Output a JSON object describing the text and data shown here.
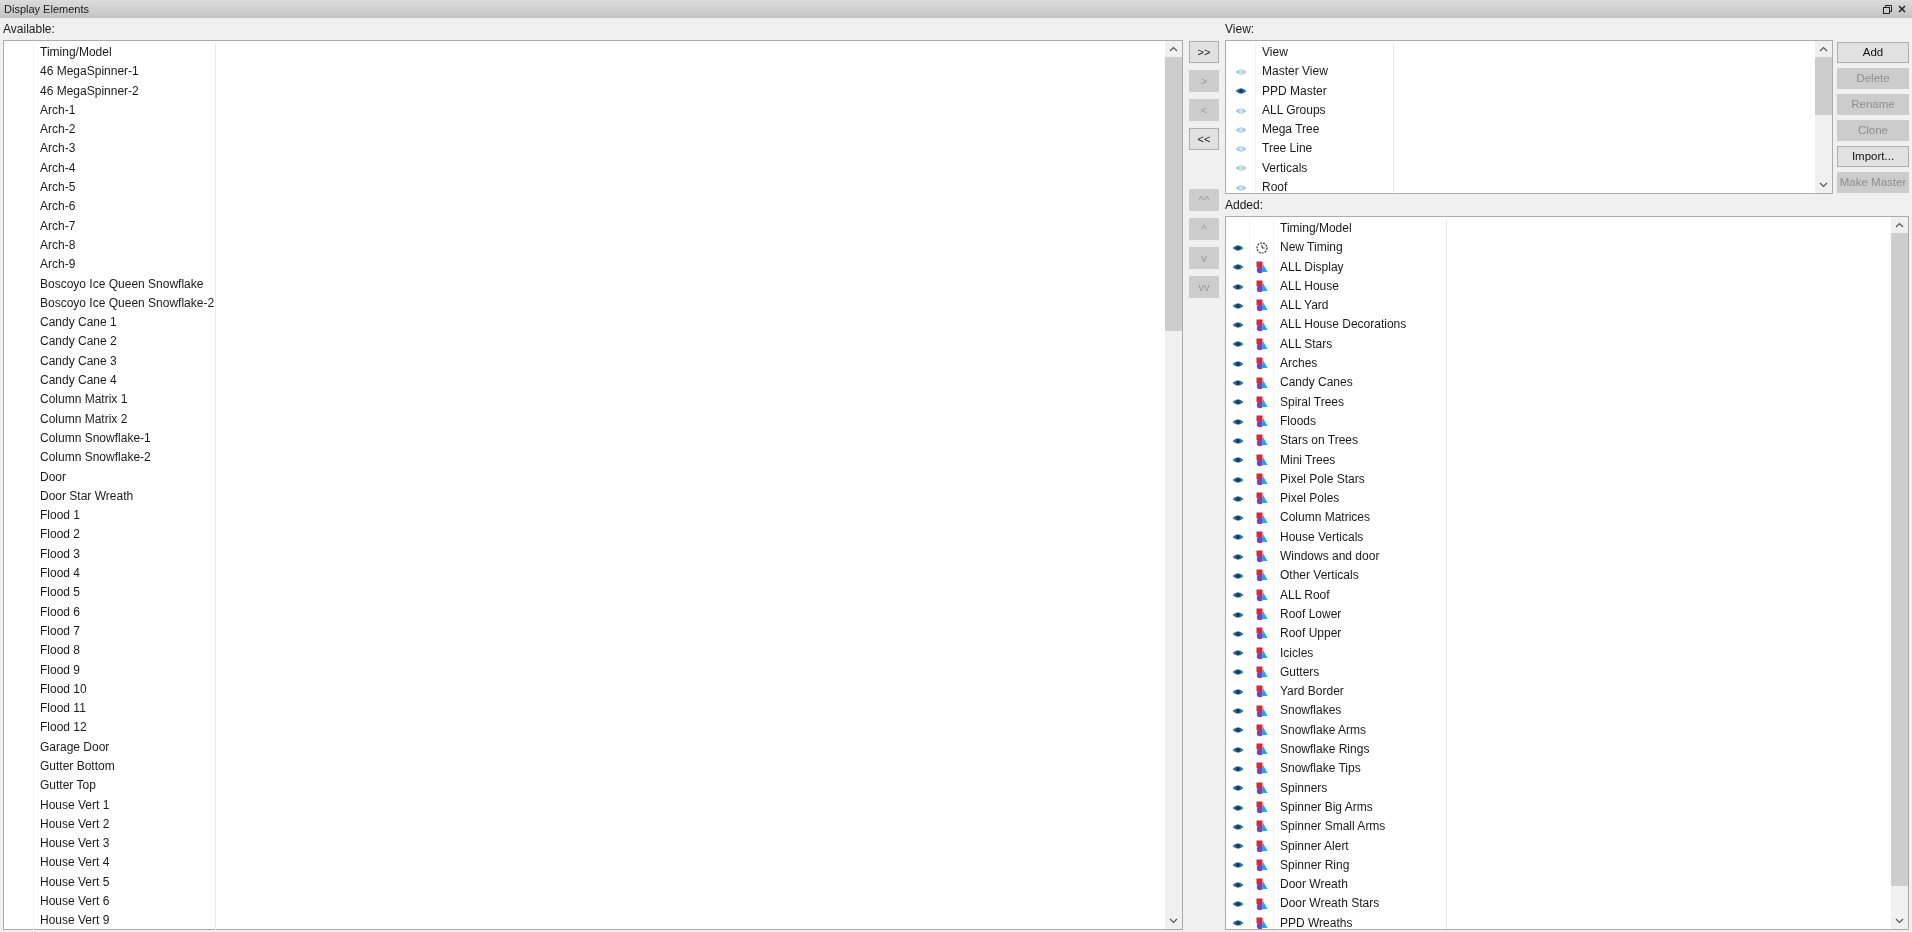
{
  "window": {
    "title": "Display Elements"
  },
  "available": {
    "label": "Available:",
    "header": "Timing/Model",
    "items": [
      "46 MegaSpinner-1",
      "46 MegaSpinner-2",
      "Arch-1",
      "Arch-2",
      "Arch-3",
      "Arch-4",
      "Arch-5",
      "Arch-6",
      "Arch-7",
      "Arch-8",
      "Arch-9",
      "Boscoyo Ice Queen Snowflake",
      "Boscoyo Ice Queen Snowflake-2",
      "Candy Cane 1",
      "Candy Cane 2",
      "Candy Cane 3",
      "Candy Cane 4",
      "Column Matrix 1",
      "Column Matrix 2",
      "Column Snowflake-1",
      "Column Snowflake-2",
      "Door",
      "Door Star Wreath",
      "Flood 1",
      "Flood 2",
      "Flood 3",
      "Flood 4",
      "Flood 5",
      "Flood 6",
      "Flood 7",
      "Flood 8",
      "Flood 9",
      "Flood 10",
      "Flood 11",
      "Flood 12",
      "Garage Door",
      "Gutter Bottom",
      "Gutter Top",
      "House Vert 1",
      "House Vert 2",
      "House Vert 3",
      "House Vert 4",
      "House Vert 5",
      "House Vert 6",
      "House Vert 9"
    ]
  },
  "transfer_buttons": [
    {
      "label": ">>",
      "disabled": false
    },
    {
      "label": ">",
      "disabled": true
    },
    {
      "label": "<",
      "disabled": true
    },
    {
      "label": "<<",
      "disabled": false
    }
  ],
  "order_buttons": [
    {
      "label": "^^",
      "disabled": true
    },
    {
      "label": "^",
      "disabled": true
    },
    {
      "label": "v",
      "disabled": true
    },
    {
      "label": "vv",
      "disabled": true
    }
  ],
  "view": {
    "label": "View:",
    "header": "View",
    "items": [
      {
        "name": "Master View",
        "selected": false
      },
      {
        "name": "PPD Master",
        "selected": true
      },
      {
        "name": "ALL Groups",
        "selected": false
      },
      {
        "name": "Mega Tree",
        "selected": false
      },
      {
        "name": "Tree Line",
        "selected": false
      },
      {
        "name": "Verticals",
        "selected": false
      },
      {
        "name": "Roof",
        "selected": false
      }
    ]
  },
  "view_buttons": [
    {
      "label": "Add",
      "disabled": false
    },
    {
      "label": "Delete",
      "disabled": true
    },
    {
      "label": "Rename",
      "disabled": true
    },
    {
      "label": "Clone",
      "disabled": true
    },
    {
      "label": "Import...",
      "disabled": false
    },
    {
      "label": "Make Master",
      "disabled": true
    }
  ],
  "added": {
    "label": "Added:",
    "header": "Timing/Model",
    "items": [
      {
        "name": "New Timing",
        "kind": "timing"
      },
      {
        "name": "ALL Display",
        "kind": "model"
      },
      {
        "name": "ALL House",
        "kind": "model"
      },
      {
        "name": "ALL Yard",
        "kind": "model"
      },
      {
        "name": "ALL House Decorations",
        "kind": "model"
      },
      {
        "name": "ALL Stars",
        "kind": "model"
      },
      {
        "name": "Arches",
        "kind": "model"
      },
      {
        "name": "Candy Canes",
        "kind": "model"
      },
      {
        "name": "Spiral Trees",
        "kind": "model"
      },
      {
        "name": "Floods",
        "kind": "model"
      },
      {
        "name": "Stars on Trees",
        "kind": "model"
      },
      {
        "name": "Mini Trees",
        "kind": "model"
      },
      {
        "name": "Pixel Pole Stars",
        "kind": "model"
      },
      {
        "name": "Pixel Poles",
        "kind": "model"
      },
      {
        "name": "Column Matrices",
        "kind": "model"
      },
      {
        "name": "House Verticals",
        "kind": "model"
      },
      {
        "name": "Windows and door",
        "kind": "model"
      },
      {
        "name": "Other Verticals",
        "kind": "model"
      },
      {
        "name": "ALL Roof",
        "kind": "model"
      },
      {
        "name": "Roof Lower",
        "kind": "model"
      },
      {
        "name": "Roof Upper",
        "kind": "model"
      },
      {
        "name": "Icicles",
        "kind": "model"
      },
      {
        "name": "Gutters",
        "kind": "model"
      },
      {
        "name": "Yard Border",
        "kind": "model"
      },
      {
        "name": "Snowflakes",
        "kind": "model"
      },
      {
        "name": "Snowflake Arms",
        "kind": "model"
      },
      {
        "name": "Snowflake Rings",
        "kind": "model"
      },
      {
        "name": "Snowflake Tips",
        "kind": "model"
      },
      {
        "name": "Spinners",
        "kind": "model"
      },
      {
        "name": "Spinner Big Arms",
        "kind": "model"
      },
      {
        "name": "Spinner Small Arms",
        "kind": "model"
      },
      {
        "name": "Spinner Alert",
        "kind": "model"
      },
      {
        "name": "Spinner Ring",
        "kind": "model"
      },
      {
        "name": "Door Wreath",
        "kind": "model"
      },
      {
        "name": "Door Wreath Stars",
        "kind": "model"
      },
      {
        "name": "PPD Wreaths",
        "kind": "model"
      }
    ]
  }
}
